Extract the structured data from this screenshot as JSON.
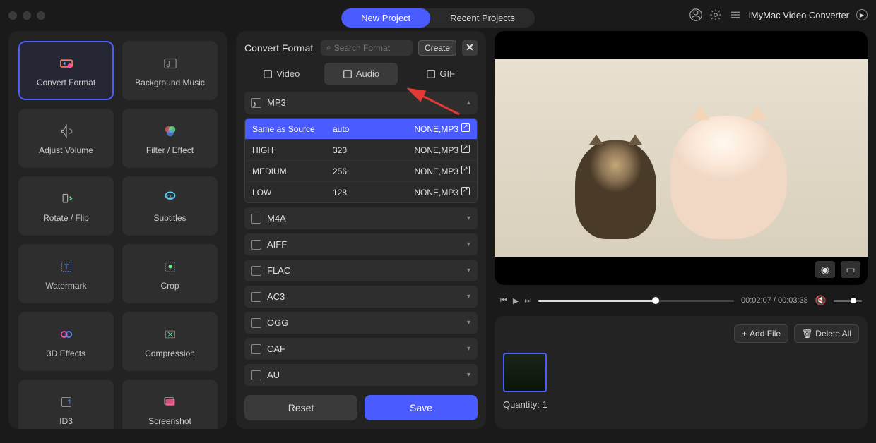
{
  "header": {
    "new_project": "New Project",
    "recent_projects": "Recent Projects",
    "app_name": "iMyMac Video Converter"
  },
  "sidebar": {
    "tools": [
      {
        "label": "Convert Format",
        "active": true,
        "icon": "convert"
      },
      {
        "label": "Background Music",
        "active": false,
        "icon": "music"
      },
      {
        "label": "Adjust Volume",
        "active": false,
        "icon": "volume"
      },
      {
        "label": "Filter / Effect",
        "active": false,
        "icon": "filter"
      },
      {
        "label": "Rotate / Flip",
        "active": false,
        "icon": "rotate"
      },
      {
        "label": "Subtitles",
        "active": false,
        "icon": "subtitles"
      },
      {
        "label": "Watermark",
        "active": false,
        "icon": "watermark"
      },
      {
        "label": "Crop",
        "active": false,
        "icon": "crop"
      },
      {
        "label": "3D Effects",
        "active": false,
        "icon": "3d"
      },
      {
        "label": "Compression",
        "active": false,
        "icon": "compress"
      },
      {
        "label": "ID3",
        "active": false,
        "icon": "id3"
      },
      {
        "label": "Screenshot",
        "active": false,
        "icon": "screenshot"
      }
    ]
  },
  "center": {
    "title": "Convert Format",
    "search_placeholder": "Search Format",
    "create": "Create",
    "tabs": [
      {
        "label": "Video",
        "active": false
      },
      {
        "label": "Audio",
        "active": true
      },
      {
        "label": "GIF",
        "active": false
      }
    ],
    "expanded_format": "MP3",
    "presets": [
      {
        "name": "Same as Source",
        "bitrate": "auto",
        "codec": "NONE,MP3",
        "selected": true
      },
      {
        "name": "HIGH",
        "bitrate": "320",
        "codec": "NONE,MP3",
        "selected": false
      },
      {
        "name": "MEDIUM",
        "bitrate": "256",
        "codec": "NONE,MP3",
        "selected": false
      },
      {
        "name": "LOW",
        "bitrate": "128",
        "codec": "NONE,MP3",
        "selected": false
      }
    ],
    "collapsed_formats": [
      "M4A",
      "AIFF",
      "FLAC",
      "AC3",
      "OGG",
      "CAF",
      "AU"
    ],
    "reset": "Reset",
    "save": "Save"
  },
  "preview": {
    "time_current": "00:02:07",
    "time_total": "00:03:38",
    "progress_pct": 60
  },
  "filelist": {
    "add_file": "Add File",
    "delete_all": "Delete All",
    "quantity_label": "Quantity:",
    "quantity_value": "1"
  }
}
